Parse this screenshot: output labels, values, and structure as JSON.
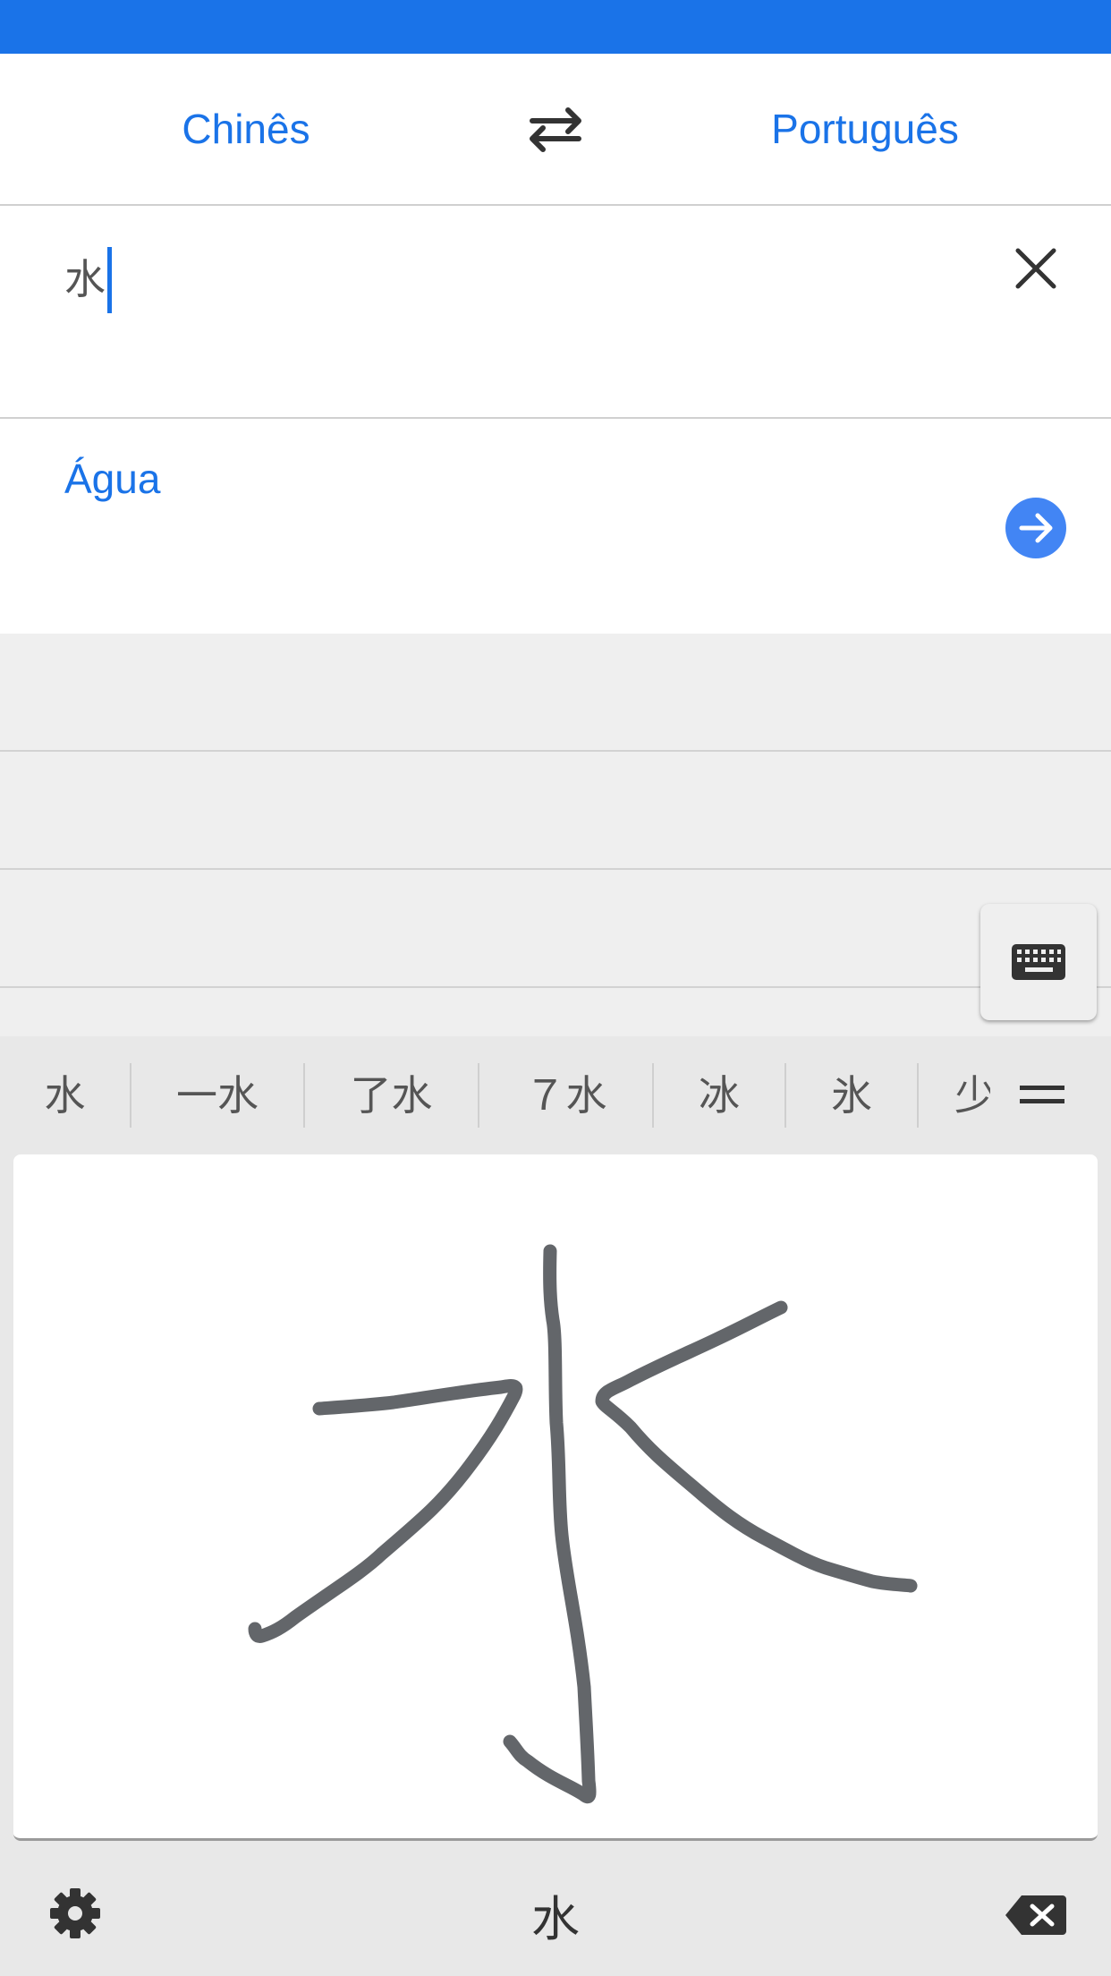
{
  "language_bar": {
    "source_language": "Chinês",
    "target_language": "Português"
  },
  "input": {
    "text": "水"
  },
  "translation": {
    "text": "Água"
  },
  "candidates": [
    "水",
    "一水",
    "了水",
    "７水",
    "冰",
    "氷",
    "少"
  ],
  "bottom_bar": {
    "space_char": "水"
  },
  "colors": {
    "accent": "#1a73e8",
    "go_button": "#4285f4",
    "ink": "#63666a"
  },
  "icons": [
    "swap-languages-icon",
    "clear-icon",
    "arrow-forward-icon",
    "keyboard-icon",
    "menu-icon",
    "settings-gear-icon",
    "backspace-icon"
  ]
}
